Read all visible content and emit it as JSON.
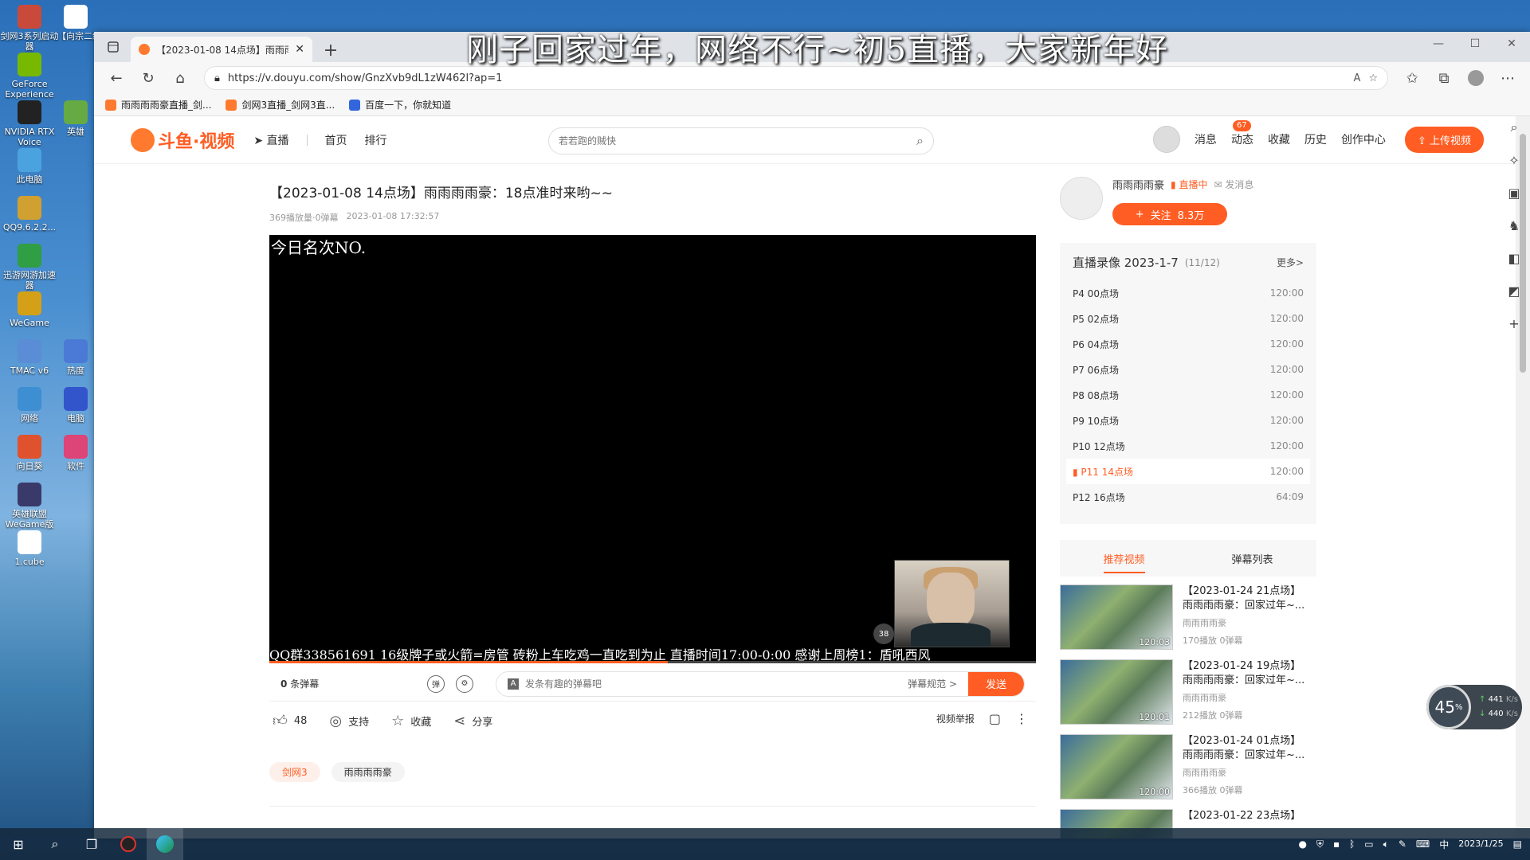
{
  "overlay_title": "刚子回家过年，网络不行~初5直播，大家新年好",
  "desktop_icons": [
    {
      "label": "剑网3系列启动器",
      "icon": "app-icon",
      "color": "#c94a3a"
    },
    {
      "label": "GeForce Experience",
      "icon": "nvidia-icon",
      "color": "#76b900"
    },
    {
      "label": "NVIDIA RTX Voice",
      "icon": "nvidia-voice-icon",
      "color": "#222"
    },
    {
      "label": "此电脑",
      "icon": "computer-icon",
      "color": "#4aa3df"
    },
    {
      "label": "QQ9.6.2.2...",
      "icon": "qq-icon",
      "color": "#d0a030"
    },
    {
      "label": "迅游网游加速器",
      "icon": "accelerator-icon",
      "color": "#2f9e44"
    },
    {
      "label": "WeGame",
      "icon": "wegame-icon",
      "color": "#d4a017"
    },
    {
      "label": "TMAC v6",
      "icon": "tmac-icon",
      "color": "#5a8dd6"
    },
    {
      "label": "网络",
      "icon": "network-icon",
      "color": "#3d8fd1"
    },
    {
      "label": "向日葵",
      "icon": "sunflower-icon",
      "color": "#e0522e"
    },
    {
      "label": "英雄联盟WeGame版",
      "icon": "lol-icon",
      "color": "#3a3a6a"
    },
    {
      "label": "1.cube",
      "icon": "file-icon",
      "color": "#ffffff"
    }
  ],
  "desktop_icons_col2": [
    {
      "label": "【向宗二级2...",
      "icon": "file-icon",
      "color": "#ffffff"
    },
    {
      "label": "英雄",
      "icon": "app-icon",
      "color": "#6a4"
    },
    {
      "label": "热度",
      "icon": "app-icon",
      "color": "#4a7ad6"
    },
    {
      "label": "电脑",
      "icon": "app-icon",
      "color": "#3355cc"
    },
    {
      "label": "软件",
      "icon": "app-icon",
      "color": "#dd4477"
    }
  ],
  "browser": {
    "tab_title": "【2023-01-08 14点场】雨雨雨...",
    "url": "https://v.douyu.com/show/GnzXvb9dL1zW462l?ap=1",
    "bookmarks": [
      "雨雨雨雨豪直播_剑...",
      "剑网3直播_剑网3直...",
      "百度一下，你就知道"
    ]
  },
  "header": {
    "logo": "斗鱼·视频",
    "nav": [
      "直播",
      "首页",
      "排行"
    ],
    "search_placeholder": "若若跑的贼快",
    "right_links": [
      "消息",
      "动态",
      "收藏",
      "历史",
      "创作中心"
    ],
    "dynamic_badge": "67",
    "upload_label": "上传视频"
  },
  "video": {
    "title": "【2023-01-08 14点场】雨雨雨雨豪：18点准时来哟~~",
    "views": "369播放量·0弹幕",
    "date": "2023-01-08 17:32:57",
    "overlay_top": "今日名次NO.",
    "overlay_bottom": "QQ群338561691 16级牌子或火箭=房管 砖粉上车吃鸡一直吃到为止 直播时间17:00-0:00 感谢上周榜1：盾吼西风",
    "cam_badge": "38",
    "progress_pct": 52
  },
  "danmu": {
    "count": "0",
    "count_label": "条弹幕",
    "input_placeholder": "发条有趣的弹幕吧",
    "rules": "弹幕规范 >",
    "send": "发送"
  },
  "actions": {
    "like_count": "48",
    "support": "支持",
    "fav": "收藏",
    "share": "分享",
    "report": "视频举报"
  },
  "tags": [
    "剑网3",
    "雨雨雨雨豪"
  ],
  "uploader": {
    "name": "雨雨雨雨豪",
    "live": "直播中",
    "message": "发消息",
    "follow": "关注",
    "followers": "8.3万"
  },
  "replay": {
    "title": "直播录像 2023-1-7",
    "count": "(11/12)",
    "more": "更多>",
    "episodes": [
      {
        "name": "P4 00点场",
        "dur": "120:00",
        "active": false
      },
      {
        "name": "P5 02点场",
        "dur": "120:00",
        "active": false
      },
      {
        "name": "P6 04点场",
        "dur": "120:00",
        "active": false
      },
      {
        "name": "P7 06点场",
        "dur": "120:00",
        "active": false
      },
      {
        "name": "P8 08点场",
        "dur": "120:00",
        "active": false
      },
      {
        "name": "P9 10点场",
        "dur": "120:00",
        "active": false
      },
      {
        "name": "P10 12点场",
        "dur": "120:00",
        "active": false
      },
      {
        "name": "P11 14点场",
        "dur": "120:00",
        "active": true
      },
      {
        "name": "P12 16点场",
        "dur": "64:09",
        "active": false
      }
    ]
  },
  "rec_tabs": [
    "推荐视频",
    "弹幕列表"
  ],
  "recommended": [
    {
      "title": "【2023-01-24 21点场】",
      "subtitle": "雨雨雨雨豪：回家过年~...",
      "author": "雨雨雨雨豪",
      "views": "170播放",
      "danmu": "0弹幕",
      "dur": "120:03"
    },
    {
      "title": "【2023-01-24 19点场】",
      "subtitle": "雨雨雨雨豪：回家过年~...",
      "author": "雨雨雨雨豪",
      "views": "212播放",
      "danmu": "0弹幕",
      "dur": "120:01"
    },
    {
      "title": "【2023-01-24 01点场】",
      "subtitle": "雨雨雨雨豪：回家过年~...",
      "author": "雨雨雨雨豪",
      "views": "366播放",
      "danmu": "0弹幕",
      "dur": "120:00"
    },
    {
      "title": "【2023-01-22 23点场】",
      "subtitle": "",
      "author": "",
      "views": "",
      "danmu": "",
      "dur": ""
    }
  ],
  "speed_widget": {
    "pct": "45",
    "up": "441",
    "down": "440",
    "unit": "K/s"
  },
  "taskbar": {
    "date": "2023/1/25",
    "ime": "中"
  }
}
